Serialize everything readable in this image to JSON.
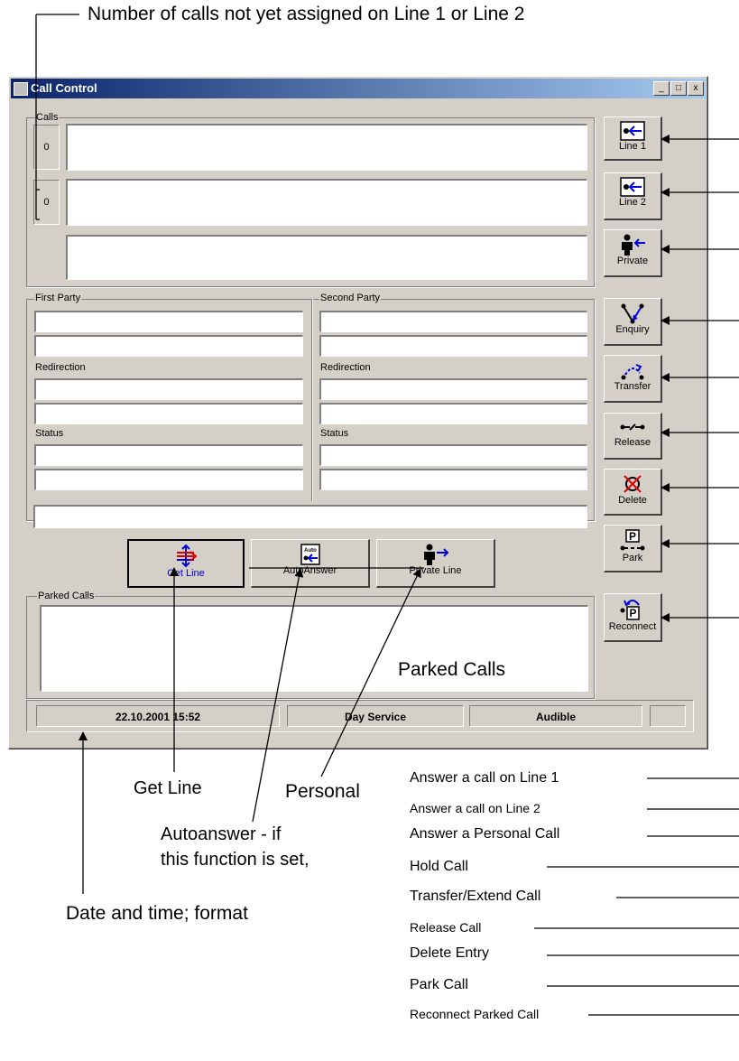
{
  "callouts": {
    "top": "Number of calls not yet assigned on Line 1 or Line 2",
    "get_line": "Get Line",
    "personal": "Personal",
    "autoanswer_line1": "Autoanswer - if",
    "autoanswer_line2": "this function is set,",
    "date_time": "Date and time; format",
    "parked_calls": "Parked Calls"
  },
  "right_labels": [
    "Answer a call on Line 1",
    "Answer a call on Line 2",
    "Answer a Personal Call",
    "Hold Call",
    "Transfer/Extend Call",
    "Release Call",
    "Delete Entry",
    "Park Call",
    "Reconnect Parked Call"
  ],
  "window": {
    "title": "Call Control",
    "controls": [
      "_",
      "□",
      "x"
    ]
  },
  "calls": {
    "group_label": "Calls",
    "line1_count": "0",
    "line2_count": "0"
  },
  "parties": {
    "first_party": "First Party",
    "second_party": "Second Party",
    "redirection_left": "Redirection",
    "redirection_right": "Redirection",
    "status_left": "Status",
    "status_right": "Status"
  },
  "side_buttons": {
    "line1": "Line 1",
    "line2": "Line 2",
    "private": "Private",
    "enquiry": "Enquiry",
    "transfer": "Transfer",
    "release": "Release",
    "delete": "Delete",
    "park": "Park",
    "reconnect": "Reconnect"
  },
  "bottom_buttons": {
    "get_line": "Get Line",
    "autoanswer": "AutoAnswer",
    "private_line": "Private Line"
  },
  "parked": {
    "group_label": "Parked Calls"
  },
  "status_bar": {
    "datetime": "22.10.2001 15:52",
    "service": "Day Service",
    "ring": "Audible"
  },
  "icons": [
    "line-in-icon",
    "person-icon",
    "enquiry-icon",
    "transfer-icon",
    "release-icon",
    "delete-icon",
    "park-icon",
    "reconnect-icon",
    "get-line-icon",
    "autoanswer-icon"
  ]
}
